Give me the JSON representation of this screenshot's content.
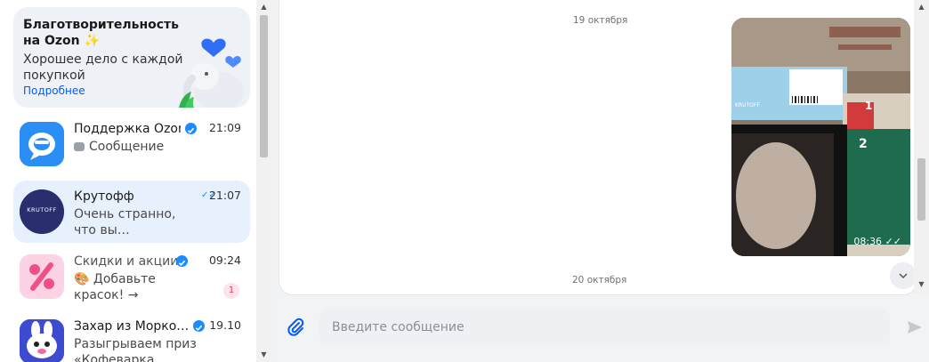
{
  "promo": {
    "title": "Благотворительность на Ozon ✨",
    "subtitle": "Хорошее дело с каждой покупкой",
    "link": "Подробнее"
  },
  "chats": [
    {
      "name": "Поддержка Ozon",
      "time": "21:09",
      "preview": "Сообщение",
      "preview_icon": "chat-bubble-icon",
      "verified": true,
      "read_ticks": false,
      "badge": ""
    },
    {
      "name": "Крутофф",
      "time": "21:07",
      "preview": "Очень странно, что вы…",
      "verified": false,
      "read_ticks": true,
      "badge": "",
      "avatar_text": "KRUTOFF"
    },
    {
      "name": "Скидки и акции",
      "time": "09:24",
      "preview": "🎨 Добавьте красок! →",
      "verified": true,
      "read_ticks": false,
      "badge": "1"
    },
    {
      "name": "Захар из Морко…",
      "time": "19.10",
      "preview": "Разыгрываем приз «Кофеварка",
      "verified": true,
      "read_ticks": false,
      "badge": ""
    }
  ],
  "conversation": {
    "date_1": "19 октября",
    "date_2": "20 октября",
    "photo_time": "08:36",
    "photo_ticks": "✓✓"
  },
  "composer": {
    "placeholder": "Введите сообщение"
  },
  "colors": {
    "accent": "#005bff",
    "active_chat": "#e6f1fd",
    "verified": "#1a8cff",
    "badge_text": "#e53960"
  }
}
